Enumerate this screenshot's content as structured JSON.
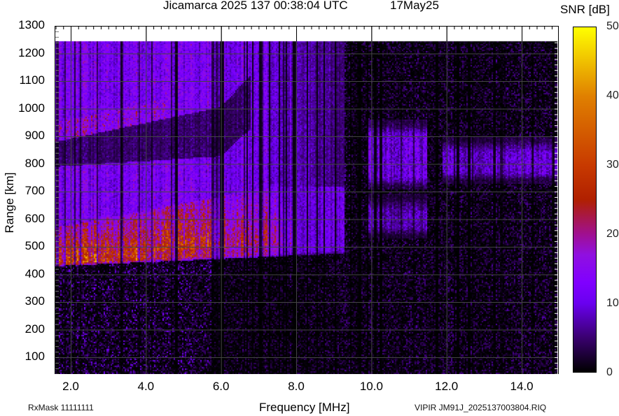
{
  "header": {
    "title": "Jicamarca 2025 137 00:38:04 UTC",
    "date": "17May25",
    "colorbar_label": "SNR [dB]"
  },
  "footer": {
    "rx_mask": "RxMask 11111111",
    "file_label": "VIPIR  JM91J_2025137003804.RIQ"
  },
  "chart_data": {
    "type": "heatmap",
    "title": "Jicamarca 2025 137 00:38:04 UTC",
    "xlabel": "Frequency [MHz]",
    "ylabel": "Range [km]",
    "xlim": [
      1.57,
      15.0
    ],
    "ylim": [
      40,
      1300
    ],
    "data_range_top_km": 1244,
    "grid": true,
    "x_ticks": [
      "2.0",
      "4.0",
      "6.0",
      "8.0",
      "10.0",
      "12.0",
      "14.0"
    ],
    "x_tick_values": [
      2,
      4,
      6,
      8,
      10,
      12,
      14
    ],
    "y_ticks": [
      "1300",
      "1200",
      "1100",
      "1000",
      "900",
      "800",
      "700",
      "600",
      "500",
      "400",
      "300",
      "200",
      "100"
    ],
    "y_tick_values": [
      1300,
      1200,
      1100,
      1000,
      900,
      800,
      700,
      600,
      500,
      400,
      300,
      200,
      100
    ],
    "colorbar": {
      "label": "SNR [dB]",
      "range": [
        0,
        50
      ],
      "ticks": [
        "50",
        "40",
        "30",
        "20",
        "10",
        "0"
      ],
      "stops": [
        [
          0,
          "#000000"
        ],
        [
          5,
          "#3a0070"
        ],
        [
          10,
          "#6a00f0"
        ],
        [
          13,
          "#8000ff"
        ],
        [
          17,
          "#9010e0"
        ],
        [
          20,
          "#a01090"
        ],
        [
          25,
          "#b02000"
        ],
        [
          30,
          "#c83a00"
        ],
        [
          40,
          "#e08000"
        ],
        [
          50,
          "#ffff00"
        ]
      ]
    },
    "f_trace": {
      "freq_range_MHz": [
        1.6,
        9.3
      ],
      "lower_edge_km": [
        430,
        476
      ],
      "core_top_km": [
        570,
        766
      ],
      "core_snr_dB": 31,
      "diffuse_snr_dB": 12,
      "gap_upper_km": [
        880,
        1100
      ]
    },
    "patches": [
      {
        "f": [
          9.9,
          11.5
        ],
        "h": [
          710,
          960
        ],
        "snr": 11
      },
      {
        "f": [
          9.9,
          11.5
        ],
        "h": [
          530,
          690
        ],
        "snr": 8
      },
      {
        "f": [
          11.9,
          15.0
        ],
        "h": [
          730,
          900
        ],
        "snr": 10
      }
    ],
    "blanked_channels_MHz": [
      3.35,
      4.8,
      4.83,
      6.0,
      6.05,
      6.7,
      6.85,
      7.05,
      7.3,
      7.55,
      7.75,
      7.95,
      8.3,
      8.55,
      8.75,
      9.05,
      9.45,
      9.7,
      9.9,
      10.1,
      10.25,
      11.75,
      12.3,
      12.6,
      13.3,
      14.3,
      14.85
    ]
  }
}
